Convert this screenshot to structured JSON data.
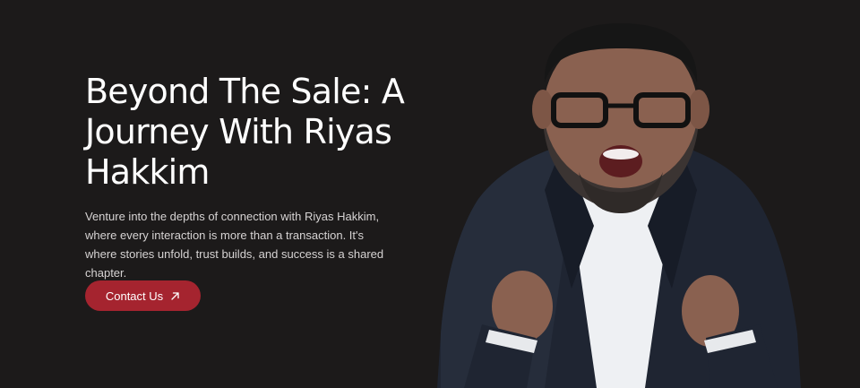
{
  "hero": {
    "title": "Beyond The Sale: A Journey With Riyas Hakkim",
    "description": "Venture into the depths of connection with Riyas Hakkim, where every interaction is more than a transaction. It's where stories unfold, trust builds, and success is a shared chapter.",
    "cta_label": "Contact Us",
    "cta_icon": "arrow-up-right-icon"
  },
  "colors": {
    "background": "#1c1a1a",
    "accent": "#a5242f",
    "text": "#ffffff",
    "muted_text": "#d6d3d3"
  }
}
